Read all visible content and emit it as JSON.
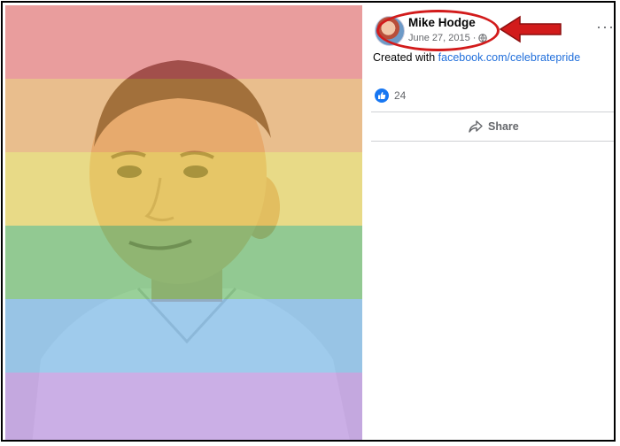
{
  "post": {
    "author": "Mike Hodge",
    "date": "June 27, 2015",
    "date_separator": "·",
    "caption_prefix": "Created with ",
    "caption_link": "facebook.com/celebratepride",
    "reaction_count": "24",
    "share_label": "Share",
    "more_label": "···"
  },
  "overlay_colors": [
    "#f7a6a6",
    "#f8c68f",
    "#f6e27d",
    "#93d08f",
    "#9cc9ee",
    "#c7a8e6"
  ],
  "icons": {
    "avatar": "profile-avatar",
    "globe": "globe-icon",
    "like": "like-icon",
    "share": "share-icon",
    "more": "more-options-icon"
  },
  "annotation_color": "#d21b1b"
}
